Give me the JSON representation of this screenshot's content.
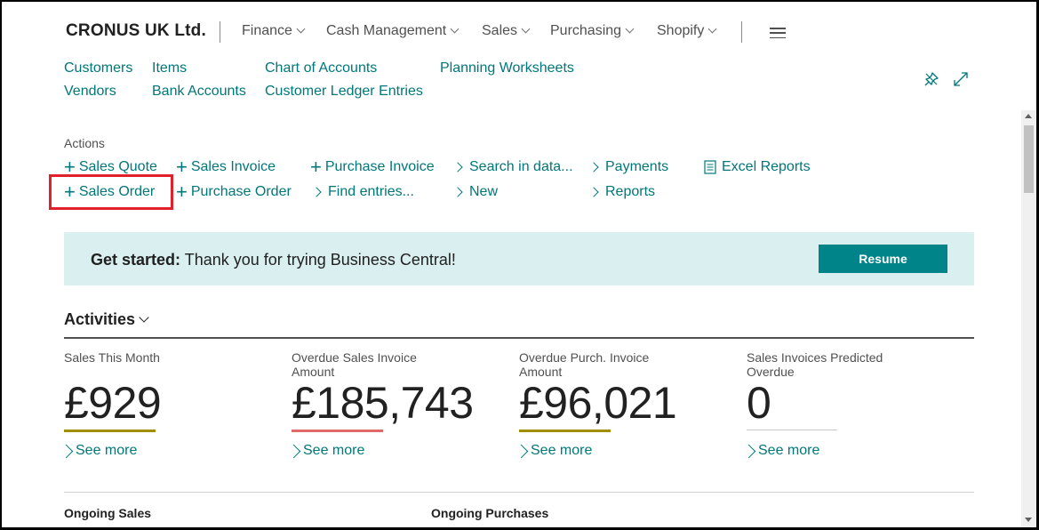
{
  "header": {
    "company": "CRONUS UK Ltd.",
    "menus": [
      "Finance",
      "Cash Management",
      "Sales",
      "Purchasing",
      "Shopify"
    ]
  },
  "links": {
    "customers": "Customers",
    "vendors": "Vendors",
    "items": "Items",
    "bank_accounts": "Bank Accounts",
    "chart_of_accounts": "Chart of Accounts",
    "customer_ledger_entries": "Customer Ledger Entries",
    "planning_worksheets": "Planning Worksheets"
  },
  "actions": {
    "label": "Actions",
    "sales_quote": "Sales Quote",
    "sales_order": "Sales Order",
    "sales_invoice": "Sales Invoice",
    "purchase_order": "Purchase Order",
    "purchase_invoice": "Purchase Invoice",
    "find_entries": "Find entries...",
    "search_in_data": "Search in data...",
    "new": "New",
    "payments": "Payments",
    "reports": "Reports",
    "excel_reports": "Excel Reports"
  },
  "banner": {
    "lead": "Get started:",
    "text": "Thank you for trying Business Central!",
    "button": "Resume"
  },
  "activities": {
    "title": "Activities",
    "tiles": [
      {
        "label_line1": "Sales This Month",
        "label_line2": "",
        "value": "£929",
        "bar_color": "#a09000",
        "more": "See more"
      },
      {
        "label_line1": "Overdue Sales Invoice",
        "label_line2": "Amount",
        "value": "£185,743",
        "bar_color": "#e06a68",
        "more": "See more"
      },
      {
        "label_line1": "Overdue Purch. Invoice",
        "label_line2": "Amount",
        "value": "£96,021",
        "bar_color": "#a09000",
        "more": "See more"
      },
      {
        "label_line1": "Sales Invoices Predicted",
        "label_line2": "Overdue",
        "value": "0",
        "bar_color": "#c8c8c8",
        "more": "See more"
      }
    ]
  },
  "sections": {
    "ongoing_sales": "Ongoing Sales",
    "ongoing_purchases": "Ongoing Purchases"
  },
  "icons": {
    "pin": "pin-icon",
    "expand": "expand-icon",
    "menu": "hamburger-icon",
    "excel": "excel-report-icon"
  },
  "colors": {
    "accent": "#00777a",
    "button": "#008489",
    "banner_bg": "#d9eff0",
    "highlight": "#e0202a"
  }
}
